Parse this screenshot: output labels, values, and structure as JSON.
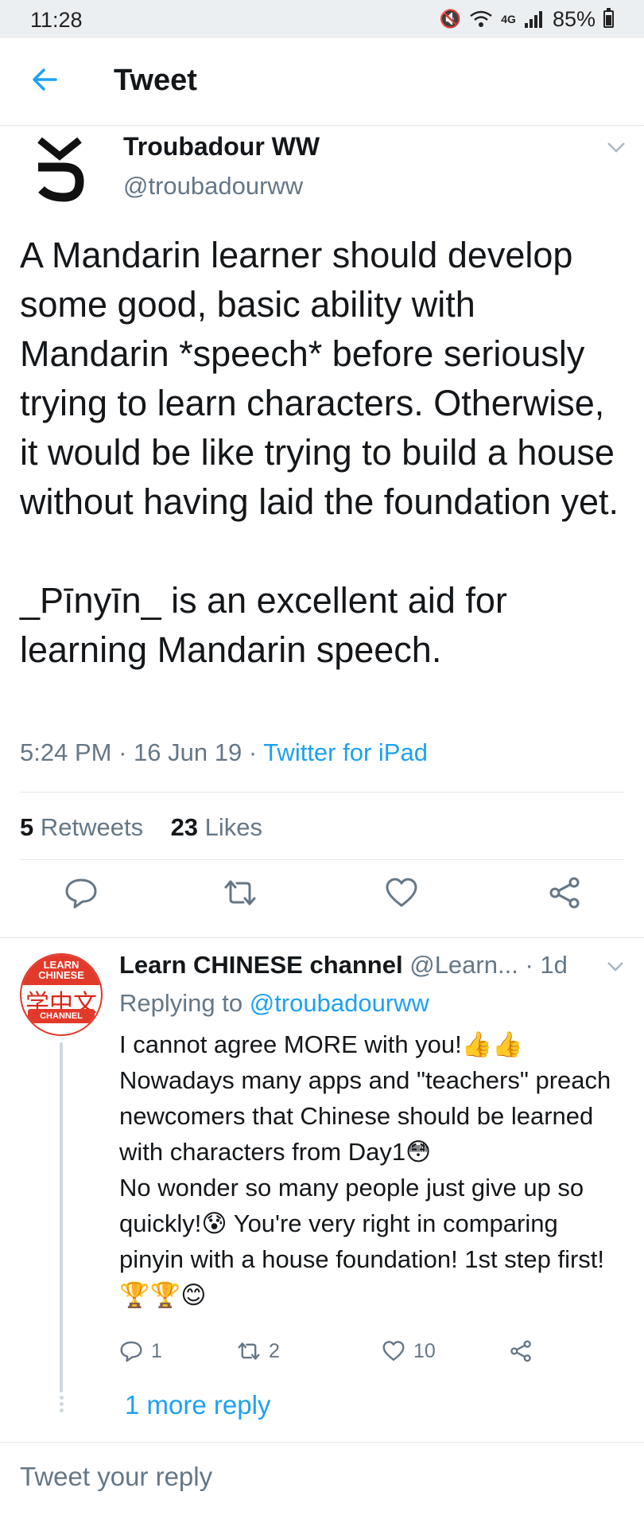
{
  "status_bar": {
    "time": "11:28",
    "network": "4G",
    "battery": "85%"
  },
  "header": {
    "back_icon": "arrow-left-icon",
    "title": "Tweet"
  },
  "tweet": {
    "author_name": "Troubadour WW",
    "author_handle": "@troubadourww",
    "text": "A Mandarin learner should develop some good, basic ability with Mandarin *speech* before seriously trying to learn characters. Otherwise, it would be like trying to build a house without having laid the foundation yet.\n\n_Pīnyīn_ is an excellent aid for learning Mandarin speech.",
    "time": "5:24 PM",
    "date": "16 Jun 19",
    "source": "Twitter for iPad",
    "retweets_count": "5",
    "retweets_label": "Retweets",
    "likes_count": "23",
    "likes_label": "Likes",
    "actions": [
      "reply-icon",
      "retweet-icon",
      "like-icon",
      "share-icon"
    ]
  },
  "reply": {
    "author_name": "Learn CHINESE channel",
    "author_handle": "@Learn...",
    "time": "1d",
    "avatar_text_top": "LEARN CHINESE",
    "avatar_text_mid": "学中文",
    "avatar_text_bottom": "CHANNEL",
    "replying_to_label": "Replying to",
    "replying_to_handle": "@troubadourww",
    "text": "I cannot agree MORE with you!👍👍\nNowadays many apps and \"teachers\" preach newcomers that Chinese should be learned with characters from Day1😳\nNo wonder so many people just give up so quickly!😰 You're very right in comparing pinyin with a house foundation! 1st step first!🏆🏆😊",
    "reply_count": "1",
    "retweet_count": "2",
    "like_count": "10",
    "more_replies": "1 more reply"
  },
  "compose": {
    "placeholder": "Tweet your reply"
  },
  "colors": {
    "accent": "#1da1f2",
    "secondary_text": "#657786",
    "divider": "#e1e8ed",
    "avatar_red": "#e23a2a"
  }
}
